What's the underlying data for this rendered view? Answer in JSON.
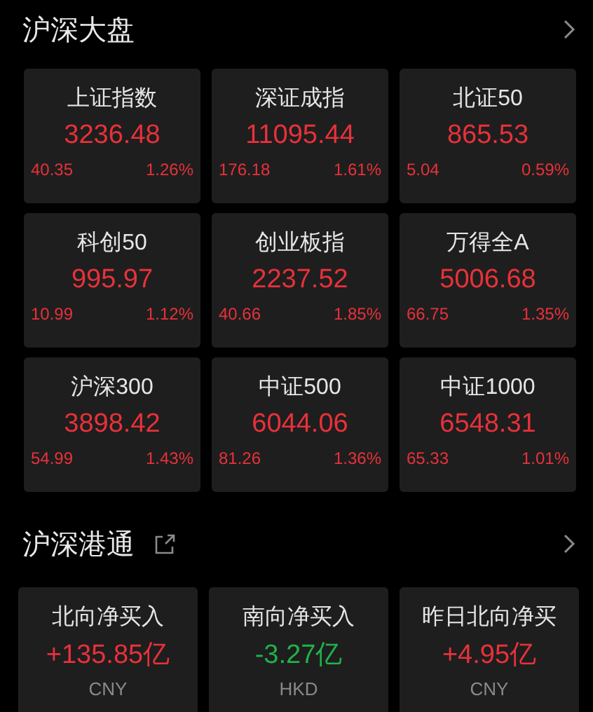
{
  "market": {
    "title": "沪深大盘",
    "indices": [
      {
        "name": "上证指数",
        "value": "3236.48",
        "change": "40.35",
        "percent": "1.26%",
        "kind": "up"
      },
      {
        "name": "深证成指",
        "value": "11095.44",
        "change": "176.18",
        "percent": "1.61%",
        "kind": "up"
      },
      {
        "name": "北证50",
        "value": "865.53",
        "change": "5.04",
        "percent": "0.59%",
        "kind": "up"
      },
      {
        "name": "科创50",
        "value": "995.97",
        "change": "10.99",
        "percent": "1.12%",
        "kind": "up"
      },
      {
        "name": "创业板指",
        "value": "2237.52",
        "change": "40.66",
        "percent": "1.85%",
        "kind": "up"
      },
      {
        "name": "万得全A",
        "value": "5006.68",
        "change": "66.75",
        "percent": "1.35%",
        "kind": "up"
      },
      {
        "name": "沪深300",
        "value": "3898.42",
        "change": "54.99",
        "percent": "1.43%",
        "kind": "up"
      },
      {
        "name": "中证500",
        "value": "6044.06",
        "change": "81.26",
        "percent": "1.36%",
        "kind": "up"
      },
      {
        "name": "中证1000",
        "value": "6548.31",
        "change": "65.33",
        "percent": "1.01%",
        "kind": "up"
      }
    ]
  },
  "connect": {
    "title": "沪深港通",
    "flows": [
      {
        "name": "北向净买入",
        "value": "+135.85亿",
        "currency": "CNY",
        "kind": "up"
      },
      {
        "name": "南向净买入",
        "value": "-3.27亿",
        "currency": "HKD",
        "kind": "down"
      },
      {
        "name": "昨日北向净买",
        "value": "+4.95亿",
        "currency": "CNY",
        "kind": "up"
      }
    ]
  }
}
